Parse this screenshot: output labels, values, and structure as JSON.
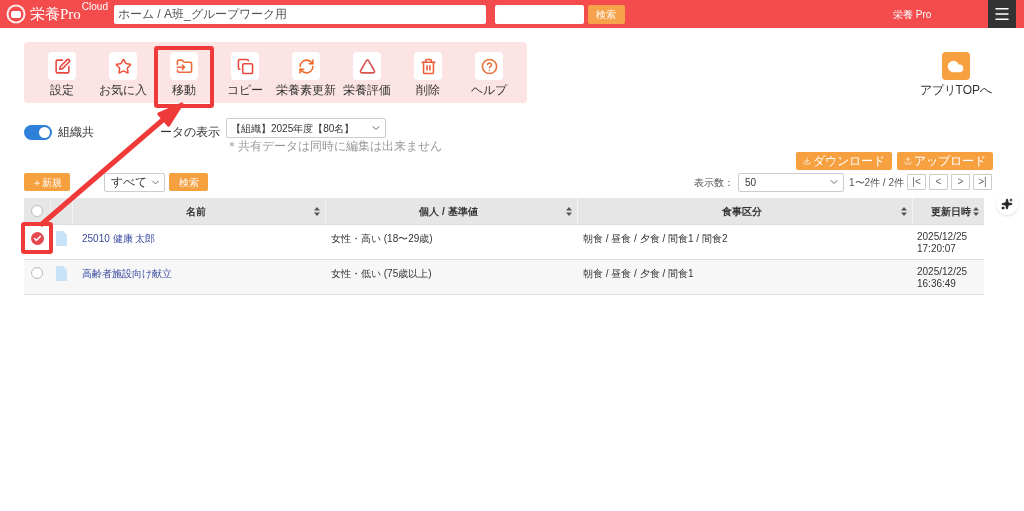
{
  "header": {
    "logo_text": "栄養Pro",
    "logo_sup": "Cloud",
    "breadcrumb": "ホーム / A班_グループワーク用",
    "search_button": "検索",
    "app_name": "栄養 Pro"
  },
  "toolbar": [
    {
      "kind": "settings",
      "label": "設定",
      "annotated": false
    },
    {
      "kind": "favorite",
      "label": "お気に入",
      "annotated": false
    },
    {
      "kind": "move",
      "label": "移動",
      "annotated": true
    },
    {
      "kind": "copy",
      "label": "コピー",
      "annotated": false
    },
    {
      "kind": "update",
      "label": "栄養素更新",
      "annotated": false
    },
    {
      "kind": "evaluate",
      "label": "栄養評価",
      "annotated": false
    },
    {
      "kind": "delete",
      "label": "削除",
      "annotated": false
    },
    {
      "kind": "help",
      "label": "ヘルプ",
      "annotated": false
    }
  ],
  "app_top": {
    "label": "アプリTOPへ"
  },
  "shared_toggle": {
    "on": true,
    "label_before": "組織共",
    "label_after": "ータの表示"
  },
  "group_select": {
    "value": "【組織】2025年度【80名】"
  },
  "shared_note": "＊共有データは同時に編集は出来ません",
  "download_button": "ダウンロード",
  "upload_button": "アップロード",
  "new_button": "＋新規",
  "filter_select": {
    "value": "すべて"
  },
  "filter_search_button": "検索",
  "page_size_label": "表示数：",
  "page_size": {
    "value": "50"
  },
  "range": "1〜2件 / 2件",
  "pager": [
    "|<",
    "<",
    ">",
    ">|"
  ],
  "table": {
    "all_selected": false,
    "columns": [
      "名前",
      "個人 / 基準値",
      "食事区分",
      "更新日時"
    ],
    "rows": [
      {
        "selected": true,
        "annotated": true,
        "name": "25010 健康 太郎",
        "standard": "女性・高い (18〜29歳)",
        "meals": "朝食 / 昼食 / 夕食 / 間食1 / 間食2",
        "updated_date": "2025/12/25",
        "updated_time": "17:20:07"
      },
      {
        "selected": false,
        "annotated": false,
        "name": "高齢者施設向け献立",
        "standard": "女性・低い (75歳以上)",
        "meals": "朝食 / 昼食 / 夕食 / 間食1",
        "updated_date": "2025/12/25",
        "updated_time": "16:36:49"
      }
    ]
  }
}
